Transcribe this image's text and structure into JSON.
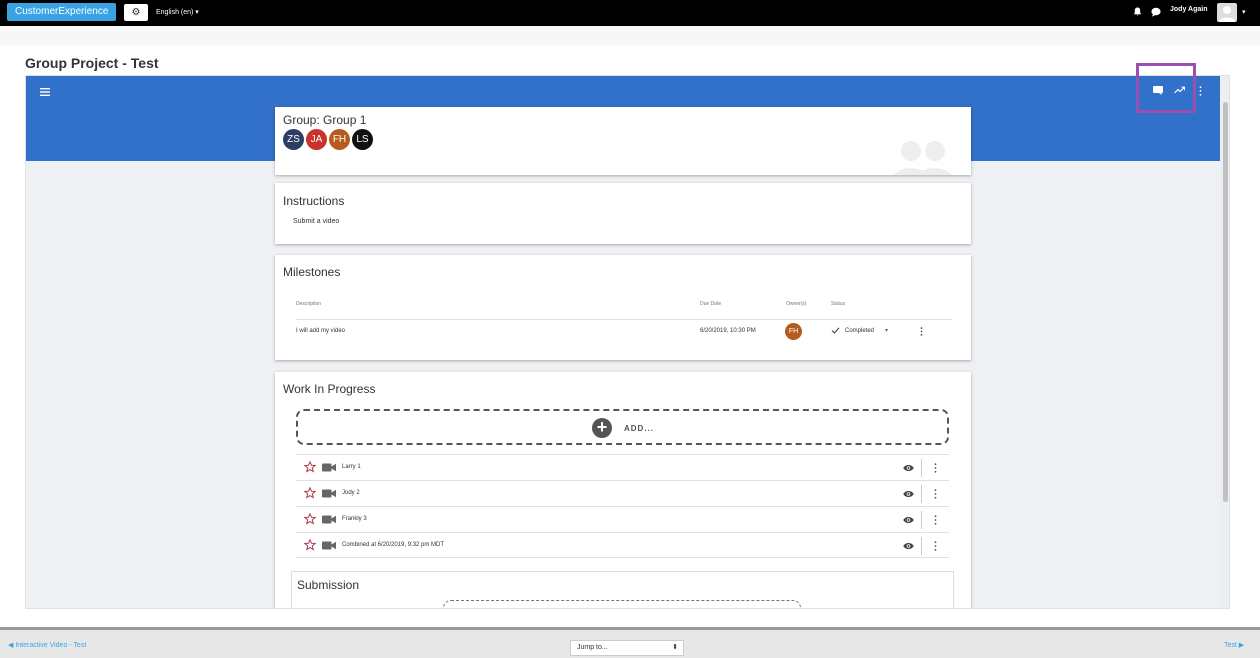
{
  "topbar": {
    "brand": "CustomerExperience",
    "language": "English (en) ▾",
    "user": "Jody Again",
    "caret": "▾"
  },
  "page": {
    "title": "Group Project - Test"
  },
  "group": {
    "title": "Group: Group 1",
    "members": [
      {
        "initials": "ZS",
        "color": "#2c3e63"
      },
      {
        "initials": "JA",
        "color": "#c8312c"
      },
      {
        "initials": "FH",
        "color": "#b45b1d"
      },
      {
        "initials": "LS",
        "color": "#111111"
      }
    ]
  },
  "instructions": {
    "title": "Instructions",
    "text": "Submit a video"
  },
  "milestones": {
    "title": "Milestones",
    "headers": {
      "description": "Description",
      "due": "Due Date",
      "owners": "Owner(s)",
      "status": "Status"
    },
    "rows": [
      {
        "description": "I will add my video",
        "due": "6/20/2019, 10:30 PM",
        "owner": "FH",
        "status": "Completed"
      }
    ]
  },
  "wip": {
    "title": "Work In Progress",
    "add_label": "ADD...",
    "items": [
      {
        "title": "Larry 1"
      },
      {
        "title": "Jody 2"
      },
      {
        "title": "Frankly 3"
      },
      {
        "title": "Combined at 6/20/2019, 9:32 pm MDT"
      }
    ]
  },
  "submission": {
    "title": "Submission"
  },
  "footer": {
    "prev": "◀ Interactive Video - Test",
    "jump": "Jump to...",
    "jump_arrow": "⬍",
    "next": "Test ▶"
  },
  "colors": {
    "blue_header": "#3271c9",
    "accent": "#3aa3e3",
    "highlight": "#9b4fb1",
    "star": "#b0384a"
  }
}
